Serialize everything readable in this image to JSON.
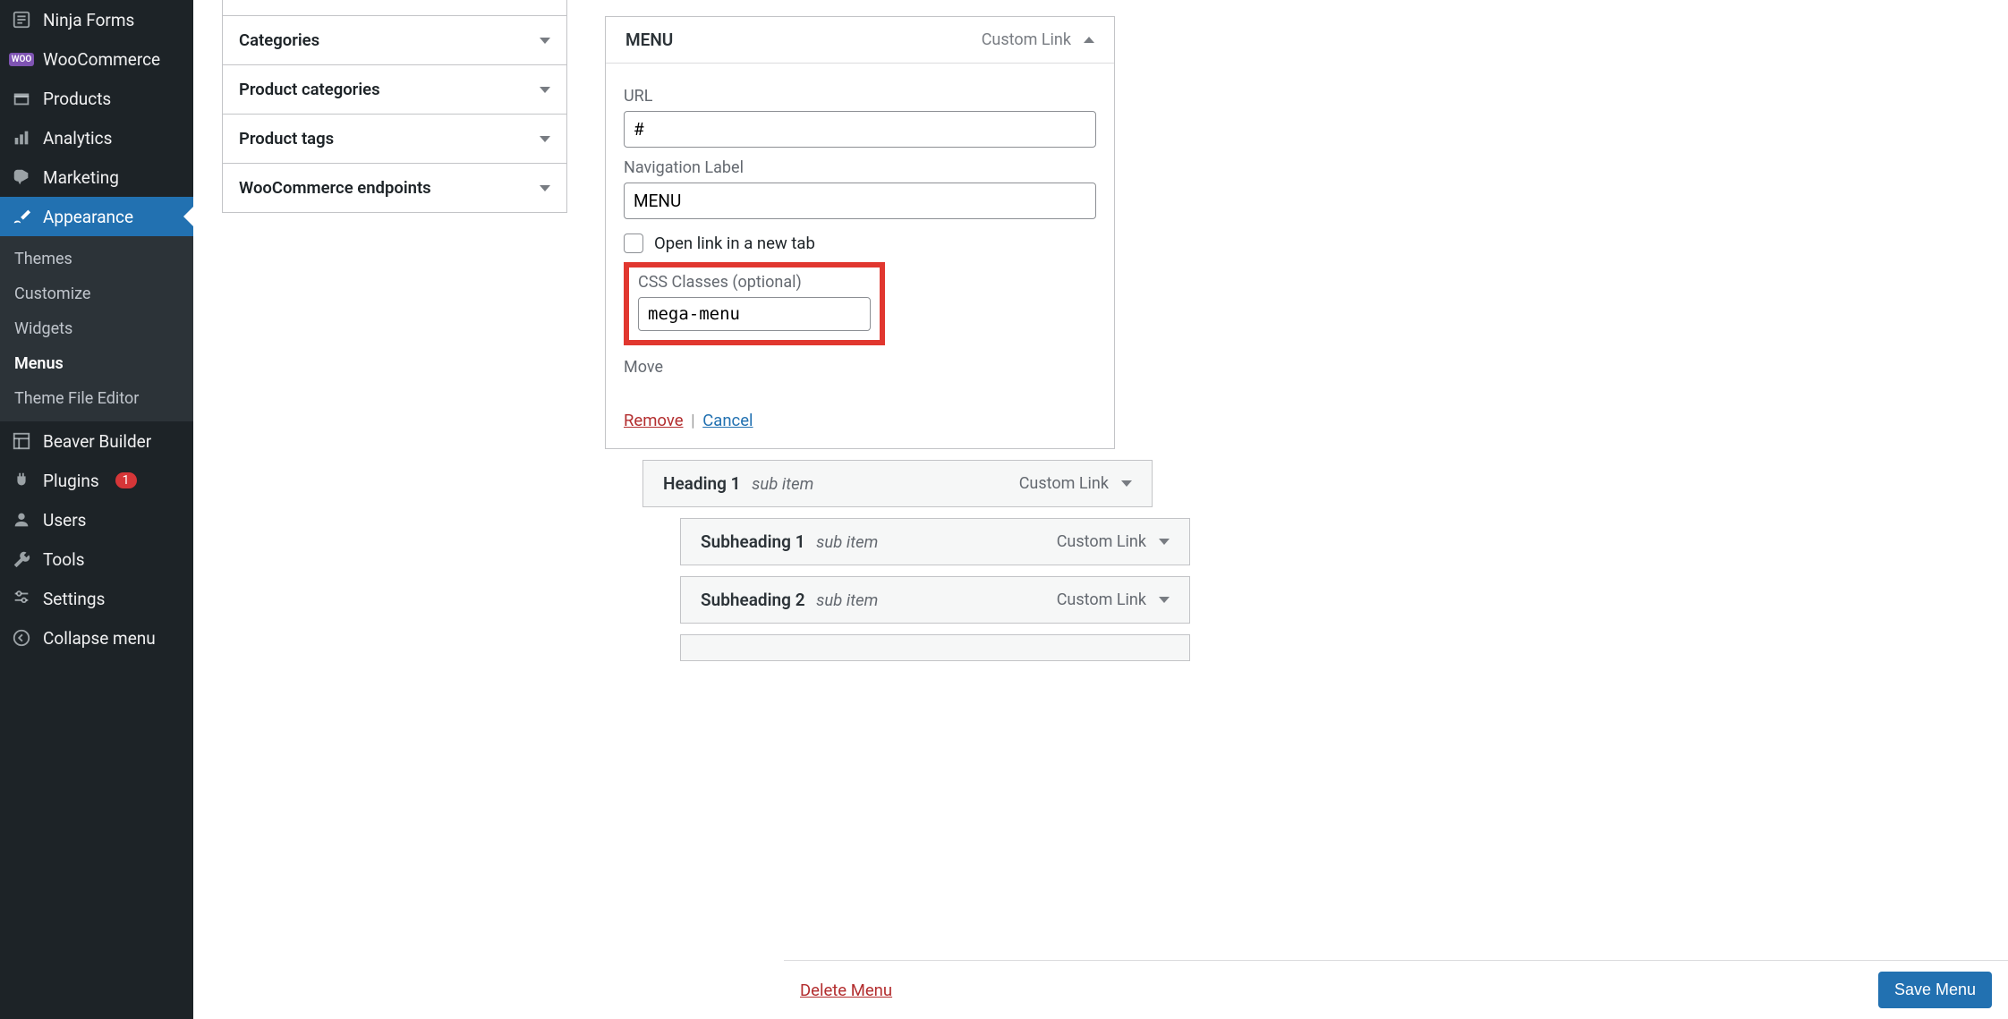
{
  "sidebar": {
    "items": [
      {
        "label": "Ninja Forms"
      },
      {
        "label": "WooCommerce"
      },
      {
        "label": "Products"
      },
      {
        "label": "Analytics"
      },
      {
        "label": "Marketing"
      },
      {
        "label": "Appearance"
      },
      {
        "label": "Beaver Builder"
      },
      {
        "label": "Plugins",
        "badge": "1"
      },
      {
        "label": "Users"
      },
      {
        "label": "Tools"
      },
      {
        "label": "Settings"
      },
      {
        "label": "Collapse menu"
      }
    ],
    "appearance_sub": [
      {
        "label": "Themes"
      },
      {
        "label": "Customize"
      },
      {
        "label": "Widgets"
      },
      {
        "label": "Menus"
      },
      {
        "label": "Theme File Editor"
      }
    ],
    "woo_badge": "WOO"
  },
  "metaboxes": [
    {
      "title": "Categories"
    },
    {
      "title": "Product categories"
    },
    {
      "title": "Product tags"
    },
    {
      "title": "WooCommerce endpoints"
    }
  ],
  "menu_item": {
    "title": "MENU",
    "type": "Custom Link",
    "url_label": "URL",
    "url_value": "#",
    "nav_label_label": "Navigation Label",
    "nav_label_value": "MENU",
    "new_tab_label": "Open link in a new tab",
    "css_classes_label": "CSS Classes (optional)",
    "css_classes_value": "mega-menu",
    "move_label": "Move",
    "remove_label": "Remove",
    "cancel_label": "Cancel"
  },
  "sub_items": [
    {
      "title": "Heading 1",
      "sub": "sub item",
      "type": "Custom Link",
      "level": 1
    },
    {
      "title": "Subheading 1",
      "sub": "sub item",
      "type": "Custom Link",
      "level": 2
    },
    {
      "title": "Subheading 2",
      "sub": "sub item",
      "type": "Custom Link",
      "level": 2
    }
  ],
  "footer": {
    "delete_label": "Delete Menu",
    "save_label": "Save Menu"
  }
}
